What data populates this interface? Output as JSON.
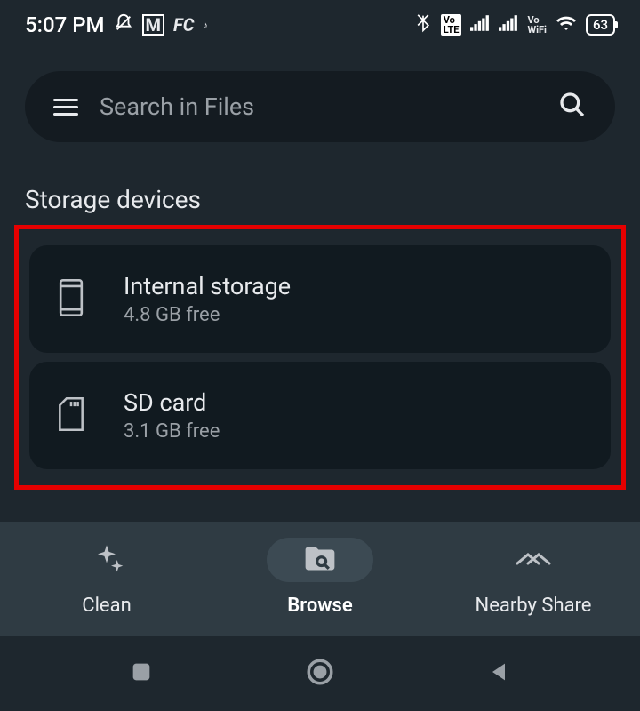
{
  "status": {
    "time": "5:07 PM",
    "battery": "63",
    "icons": {
      "m": "M",
      "fc": "FC",
      "volte": "Vo\nLTE",
      "vowifi": "Vo\nWiFi"
    }
  },
  "search": {
    "placeholder": "Search in Files"
  },
  "section": {
    "title": "Storage devices"
  },
  "storage": {
    "internal": {
      "name": "Internal storage",
      "free": "4.8 GB free"
    },
    "sd": {
      "name": "SD card",
      "free": "3.1 GB free"
    }
  },
  "nav": {
    "clean": "Clean",
    "browse": "Browse",
    "nearby": "Nearby Share"
  }
}
